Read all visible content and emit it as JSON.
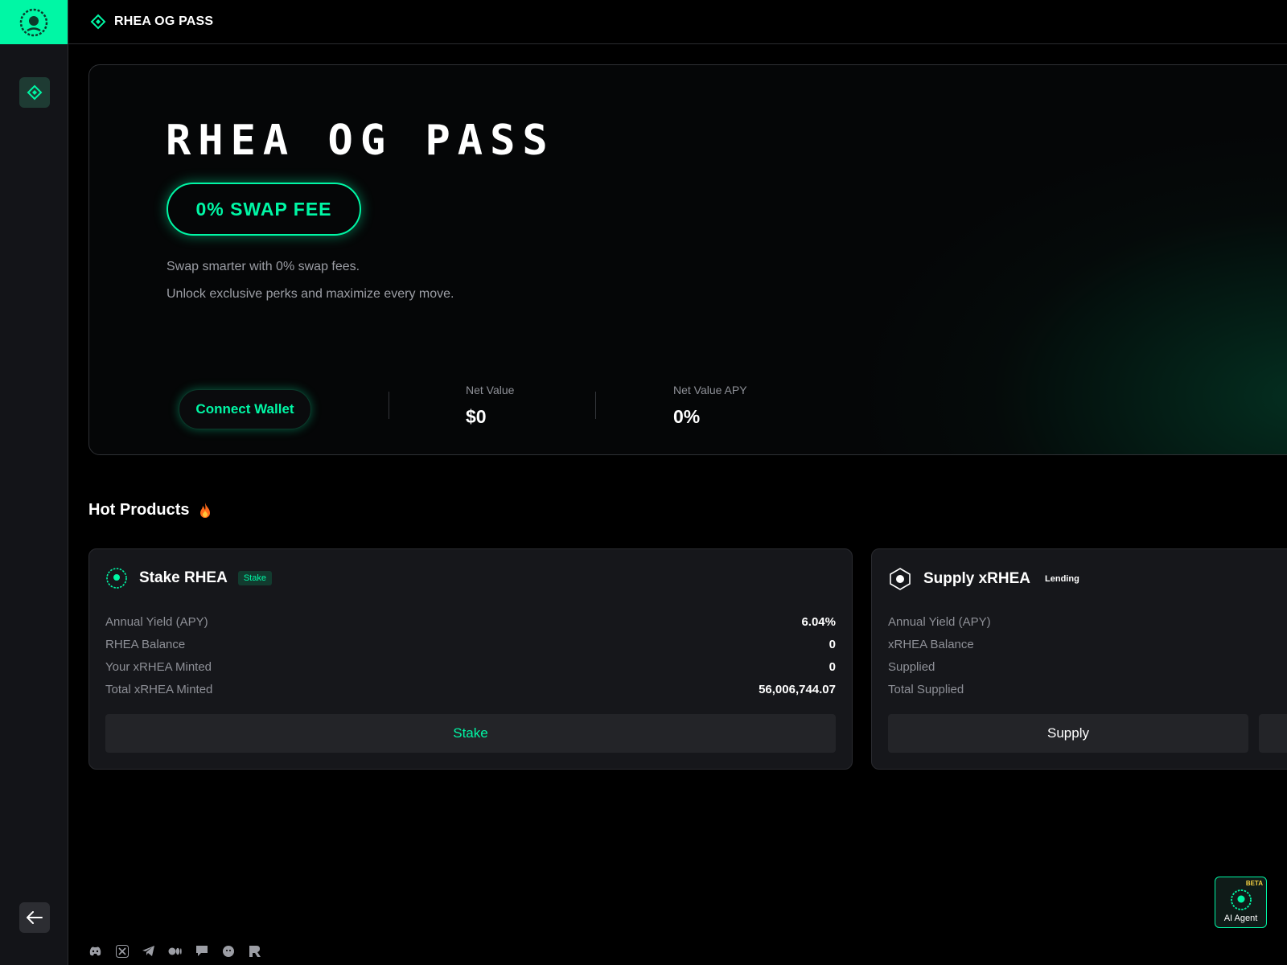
{
  "topbar": {
    "title": "RHEA OG PASS"
  },
  "hero": {
    "title": "RHEA OG PASS",
    "badge": "0% SWAP FEE",
    "subtitle_1": "Swap smarter with 0% swap fees.",
    "subtitle_2": "Unlock exclusive perks and maximize every move.",
    "connect_label": "Connect Wallet",
    "net_value_label": "Net Value",
    "net_value": "$0",
    "net_apy_label": "Net Value APY",
    "net_apy": "0%"
  },
  "hot_products": {
    "title": "Hot Products",
    "cards": [
      {
        "name": "Stake RHEA",
        "tag": "Stake",
        "rows": [
          {
            "label": "Annual Yield (APY)",
            "value": "6.04%"
          },
          {
            "label": "RHEA Balance",
            "value": "0"
          },
          {
            "label": "Your xRHEA Minted",
            "value": "0"
          },
          {
            "label": "Total xRHEA Minted",
            "value": "56,006,744.07"
          }
        ],
        "button": "Stake"
      },
      {
        "name": "Supply xRHEA",
        "tag": "Lending",
        "rows": [
          {
            "label": "Annual Yield (APY)"
          },
          {
            "label": "xRHEA Balance"
          },
          {
            "label": "Supplied"
          },
          {
            "label": "Total Supplied"
          }
        ],
        "button": "Supply"
      }
    ]
  },
  "ai_agent": {
    "label": "AI Agent",
    "beta": "BETA"
  },
  "colors": {
    "accent": "#00f7a5",
    "background": "#000000",
    "card": "#16171b"
  },
  "icons": [
    "laurel-logo-icon",
    "og-pass-icon",
    "collapse-arrow-icon",
    "discord-icon",
    "x-icon",
    "telegram-icon",
    "medium-icon",
    "chat-icon",
    "github-icon",
    "rhea-icon",
    "fire-icon"
  ]
}
